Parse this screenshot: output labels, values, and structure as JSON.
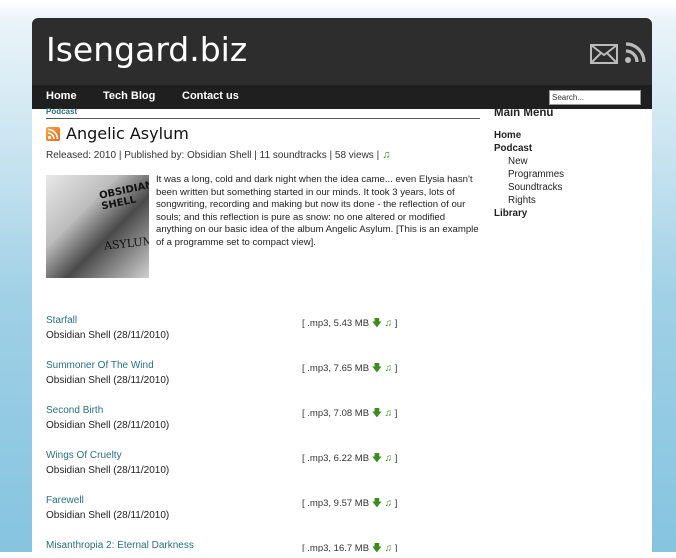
{
  "header": {
    "site_title": "Isengard.biz",
    "icons": [
      "mail-icon",
      "rss-icon"
    ]
  },
  "nav": {
    "items": [
      "Home",
      "Tech Blog",
      "Contact us"
    ],
    "search_placeholder": "Search..."
  },
  "content": {
    "breadcrumb": "Podcast",
    "title": "Angelic Asylum",
    "meta": "Released: 2010 | Published by: Obsidian Shell | 11 soundtracks | 58 views |",
    "cover_text_top": "OBSIDIAN SHELL",
    "cover_text_bottom": "ASYLUM",
    "description": "It was a long, cold and dark night when the idea came... even Elysia hasn't been written but something started in our minds. It took 3 years, lots of songwriting, recording and making but now its done - the reflection of our souls; and this reflection is pure as snow: no one altered or modified anything on our basic idea of the album Angelic Asylum. [This is an example of a programme set to compact view].",
    "tracks": [
      {
        "title": "Starfall",
        "artist": "Obsidian Shell (28/11/2010)",
        "format": "[ .mp3, 5.43 MB",
        "close": "]"
      },
      {
        "title": "Summoner Of The Wind",
        "artist": "Obsidian Shell (28/11/2010)",
        "format": "[ .mp3, 7.65 MB",
        "close": "]"
      },
      {
        "title": "Second Birth",
        "artist": "Obsidian Shell (28/11/2010)",
        "format": "[ .mp3, 7.08 MB",
        "close": "]"
      },
      {
        "title": "Wings Of Cruelty",
        "artist": "Obsidian Shell (28/11/2010)",
        "format": "[ .mp3, 6.22 MB",
        "close": "]"
      },
      {
        "title": "Farewell",
        "artist": "Obsidian Shell (28/11/2010)",
        "format": "[ .mp3, 9.57 MB",
        "close": "]"
      },
      {
        "title": "Misanthropia 2: Eternal Darkness",
        "artist": "",
        "format": "[ .mp3, 16.7 MB",
        "close": "]"
      }
    ]
  },
  "sidebar": {
    "heading": "Main Menu",
    "home": "Home",
    "podcast": "Podcast",
    "sub_items": [
      "New",
      "Programmes",
      "Soundtracks",
      "Rights"
    ],
    "library": "Library"
  },
  "colors": {
    "header_bg": "#2d2d2d",
    "link": "#2a6f7f",
    "icon_green": "#3c8d1e",
    "rss_orange": "#e56a16"
  }
}
